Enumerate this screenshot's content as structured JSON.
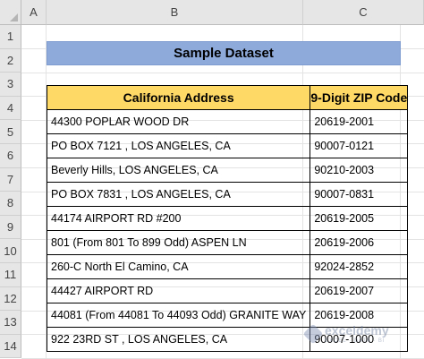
{
  "columns": [
    "A",
    "B",
    "C"
  ],
  "rows": [
    "1",
    "2",
    "3",
    "4",
    "5",
    "6",
    "7",
    "8",
    "9",
    "10",
    "11",
    "12",
    "13",
    "14"
  ],
  "title": "Sample Dataset",
  "table": {
    "headers": [
      "California Address",
      "9-Digit ZIP Code"
    ],
    "rows": [
      [
        "44300 POPLAR WOOD DR",
        "20619-2001"
      ],
      [
        "PO BOX 7121 , LOS ANGELES, CA",
        "90007-0121"
      ],
      [
        "Beverly Hills,  LOS ANGELES, CA",
        "90210-2003"
      ],
      [
        "PO BOX 7831 , LOS ANGELES, CA",
        "90007-0831"
      ],
      [
        "44174 AIRPORT RD #200",
        "20619-2005"
      ],
      [
        "801 (From 801 To 899 Odd) ASPEN LN",
        "20619-2006"
      ],
      [
        "260-C North El Camino, CA",
        "92024-2852"
      ],
      [
        "44427 AIRPORT RD",
        "20619-2007"
      ],
      [
        "44081 (From 44081 To 44093 Odd) GRANITE WAY",
        "20619-2008"
      ],
      [
        "922 23RD ST , LOS ANGELES, CA",
        "90007-1000"
      ]
    ]
  },
  "watermark": {
    "name": "exceldemy",
    "tagline": "EXCEL · DATA · BI"
  },
  "colors": {
    "title_fill": "#8eaadb",
    "header_fill": "#ffd966"
  }
}
